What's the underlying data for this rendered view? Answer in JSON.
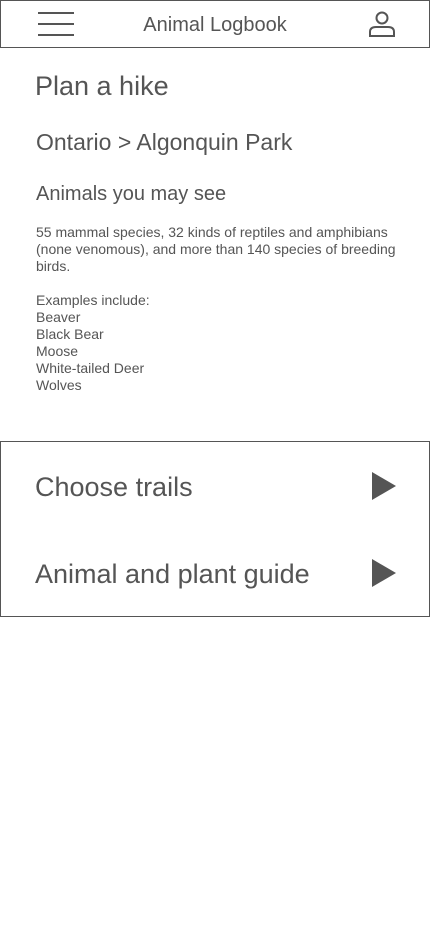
{
  "header": {
    "title": "Animal Logbook",
    "menu_icon": "hamburger-menu-icon",
    "profile_icon": "user-profile-icon"
  },
  "page": {
    "title": "Plan a hike",
    "breadcrumb": "Ontario > Algonquin Park"
  },
  "animals": {
    "heading": "Animals you may see",
    "summary": "55 mammal species, 32 kinds of reptiles and amphibians (none venomous), and more than 140 species of breeding birds.",
    "examples_label": "Examples include:",
    "examples": [
      "Beaver",
      "Black Bear",
      "Moose",
      "White-tailed Deer",
      "Wolves"
    ]
  },
  "nav": [
    {
      "label": "Choose trails",
      "icon": "play-arrow-icon"
    },
    {
      "label": "Animal and plant guide",
      "icon": "play-arrow-icon"
    }
  ],
  "colors": {
    "foreground": "#555555",
    "background": "#ffffff"
  }
}
